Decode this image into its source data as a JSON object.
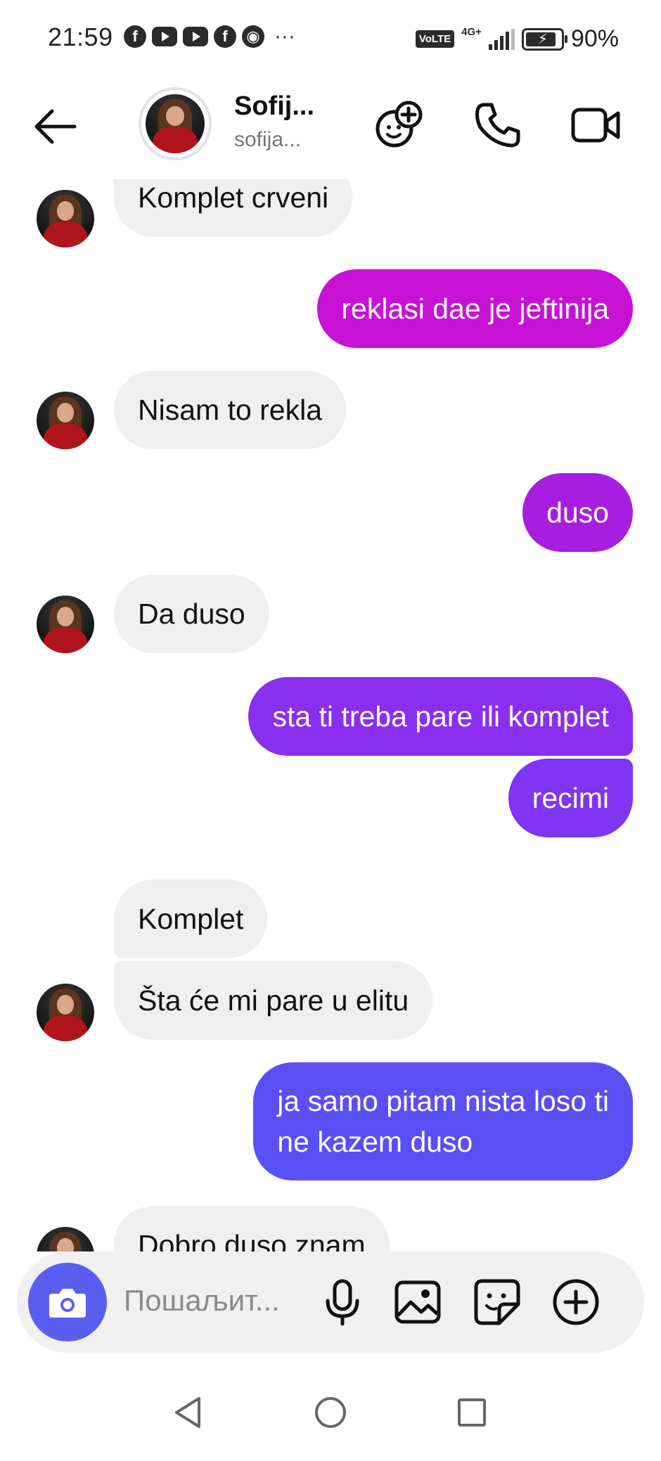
{
  "status_bar": {
    "time": "21:59",
    "notification_icons": [
      "facebook-icon",
      "youtube-icon",
      "youtube-icon",
      "facebook-icon",
      "chrome-icon"
    ],
    "more": "···",
    "volte": "VoLTE",
    "network": "4G+",
    "battery": "90%"
  },
  "header": {
    "name": "Sofij...",
    "username": "sofija..."
  },
  "messages": [
    {
      "from": "them",
      "text": "Komplet crveni"
    },
    {
      "from": "me",
      "text": "reklasi dae je jeftinija",
      "color": "#c712d6"
    },
    {
      "from": "them",
      "text": "Nisam to rekla"
    },
    {
      "from": "me",
      "text": "duso",
      "color": "#a81ee0"
    },
    {
      "from": "them",
      "text": "Da duso"
    },
    {
      "from": "me",
      "text": "sta ti treba pare ili komplet",
      "color": "#8a2ff0"
    },
    {
      "from": "me",
      "text": "recimi",
      "color": "#7f35f2"
    },
    {
      "from": "them",
      "text": "Komplet"
    },
    {
      "from": "them",
      "text": "Šta će mi pare u elitu"
    },
    {
      "from": "me",
      "text_line1": "ja samo pitam nista loso ti",
      "text_line2": "ne kazem duso",
      "color": "#5a4ff5"
    },
    {
      "from": "them",
      "text": "Dobro duso znam"
    }
  ],
  "composer": {
    "placeholder": "Пошаљит..."
  },
  "colors": {
    "camera_button": "#5a5ef0",
    "incoming_bubble": "#efefef"
  }
}
